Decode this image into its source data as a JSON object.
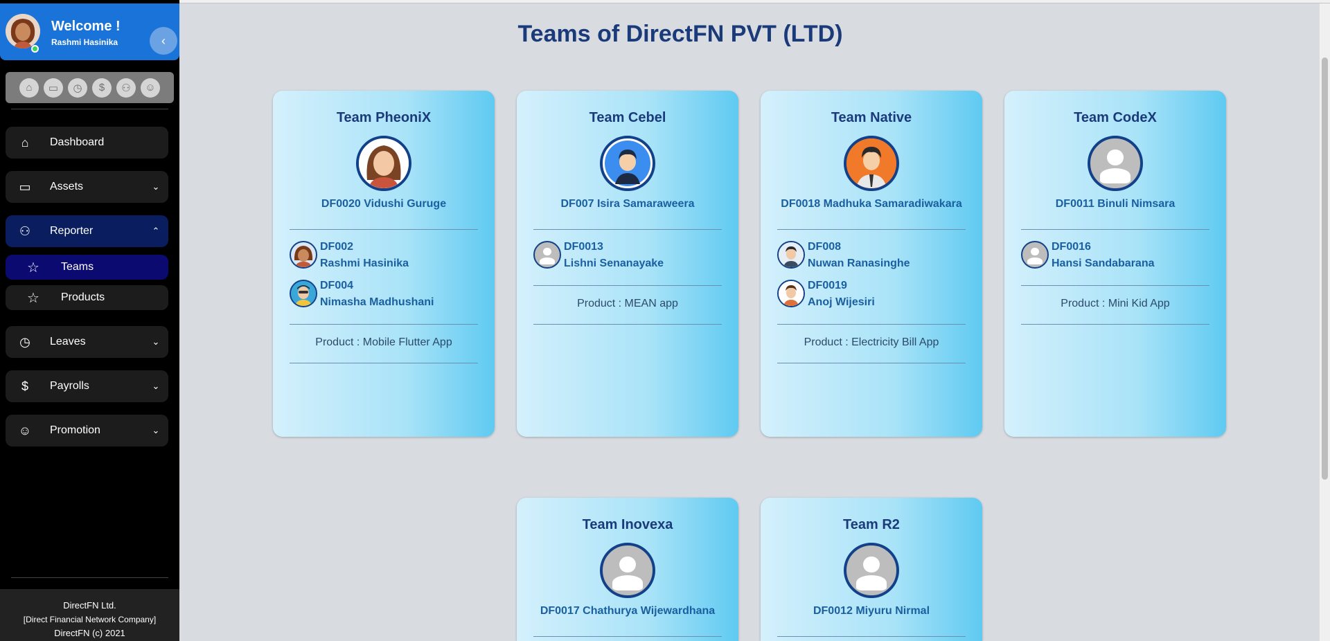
{
  "sidebar": {
    "welcome_title": "Welcome !",
    "user_name": "Rashmi Hasinika",
    "quick_icons": [
      "home-icon",
      "devices-icon",
      "clock-icon",
      "dollar-icon",
      "group-icon",
      "user-check-icon"
    ],
    "nav": {
      "dashboard": "Dashboard",
      "assets": "Assets",
      "reporter": "Reporter",
      "teams": "Teams",
      "products": "Products",
      "leaves": "Leaves",
      "payrolls": "Payrolls",
      "promotion": "Promotion"
    },
    "footer": {
      "line1": "DirectFN Ltd.",
      "line2": "[Direct Financial Network Company]",
      "line3": "DirectFN (c) 2021"
    }
  },
  "page_title": "Teams of DirectFN PVT (LTD)",
  "teams": [
    {
      "name": "Team PheoniX",
      "lead": "DF0020 Vidushi Guruge",
      "members": [
        {
          "id": "DF002",
          "name": "Rashmi Hasinika"
        },
        {
          "id": "DF004",
          "name": "Nimasha Madhushani"
        }
      ],
      "product": "Product : Mobile Flutter App"
    },
    {
      "name": "Team Cebel",
      "lead": "DF007 Isira Samaraweera",
      "members": [
        {
          "id": "DF0013",
          "name": "Lishni Senanayake"
        }
      ],
      "product": "Product : MEAN app"
    },
    {
      "name": "Team Native",
      "lead": "DF0018 Madhuka Samaradiwakara",
      "members": [
        {
          "id": "DF008",
          "name": "Nuwan Ranasinghe"
        },
        {
          "id": "DF0019",
          "name": "Anoj Wijesiri"
        }
      ],
      "product": "Product : Electricity Bill App"
    },
    {
      "name": "Team CodeX",
      "lead": "DF0011 Binuli Nimsara",
      "members": [
        {
          "id": "DF0016",
          "name": "Hansi Sandabarana"
        }
      ],
      "product": "Product : Mini Kid App"
    },
    {
      "name": "Team Inovexa",
      "lead": "DF0017 Chathurya Wijewardhana"
    },
    {
      "name": "Team R2",
      "lead": "DF0012 Miyuru Nirmal"
    }
  ]
}
